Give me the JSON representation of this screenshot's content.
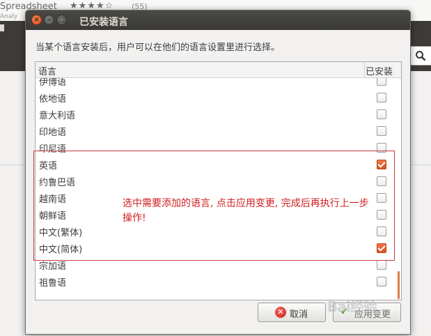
{
  "background_app": {
    "title": "Spreadsheet",
    "stars": "★★★★☆",
    "count": "(55)",
    "subtitle": "Analy"
  },
  "dialog": {
    "title": "已安装语言",
    "description": "当某个语言安装后，用户可以在他们的语言设置里进行选择。",
    "columns": {
      "language": "语言",
      "installed": "已安装"
    },
    "languages": [
      {
        "name": "伊博语",
        "installed": false
      },
      {
        "name": "依地语",
        "installed": false
      },
      {
        "name": "意大利语",
        "installed": false
      },
      {
        "name": "印地语",
        "installed": false
      },
      {
        "name": "印尼语",
        "installed": false
      },
      {
        "name": "英语",
        "installed": true
      },
      {
        "name": "约鲁巴语",
        "installed": false
      },
      {
        "name": "越南语",
        "installed": false
      },
      {
        "name": "朝鲜语",
        "installed": false
      },
      {
        "name": "中文(繁体)",
        "installed": false
      },
      {
        "name": "中文(简体)",
        "installed": true
      },
      {
        "name": "宗加语",
        "installed": false
      },
      {
        "name": "祖鲁语",
        "installed": false
      }
    ],
    "cancel_label": "取消",
    "apply_label": "应用变更"
  },
  "annotation": "选中需要添加的语言, 点击应用变更, 完成后再执行上一步操作!",
  "watermark": "Bai经验",
  "colors": {
    "accent": "#df4a17",
    "annotation": "#d0201f",
    "titlebar": "#3b3a37"
  }
}
